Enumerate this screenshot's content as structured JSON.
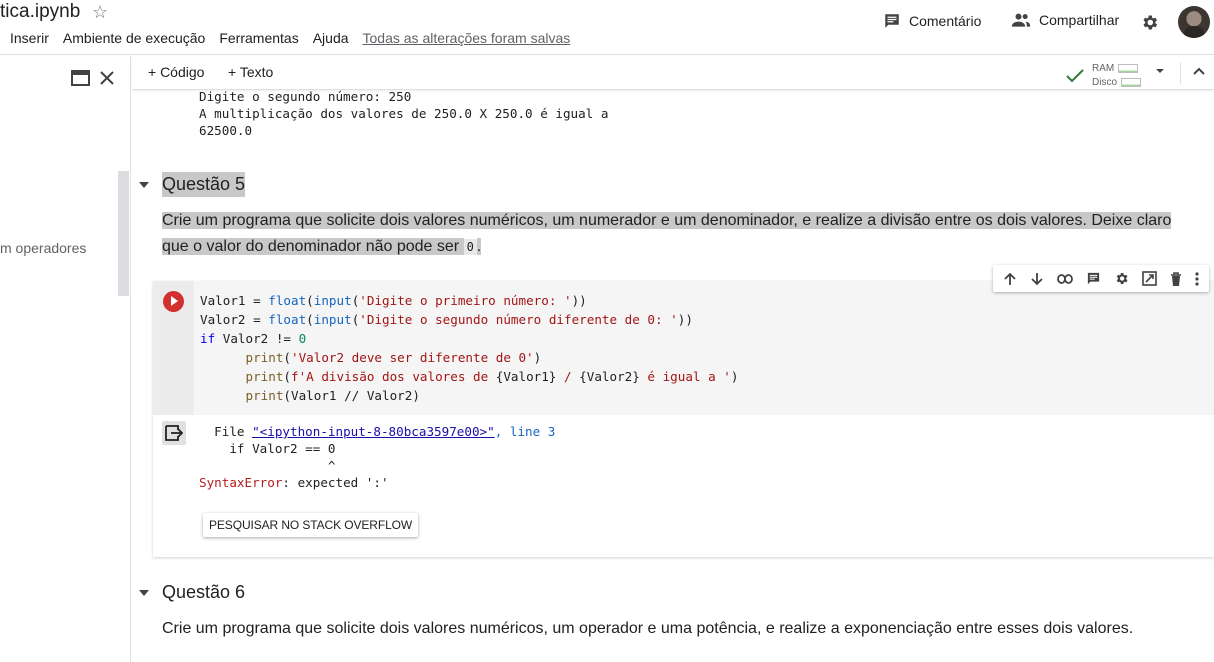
{
  "header": {
    "file_title": "tica.ipynb",
    "menu": [
      "Inserir",
      "Ambiente de execução",
      "Ferramentas",
      "Ajuda"
    ],
    "save_status": "Todas as alterações foram salvas",
    "comment_label": "Comentário",
    "share_label": "Compartilhar"
  },
  "sidebar": {
    "toc_item": "m operadores"
  },
  "toolbar": {
    "add_code": "+ Código",
    "add_text": "+ Texto",
    "ram_label": "RAM",
    "disk_label": "Disco"
  },
  "prev_output": {
    "lines": [
      "Digite o segundo número: 250",
      "A multiplicação dos valores de 250.0 X 250.0 é igual a",
      "62500.0"
    ]
  },
  "section5": {
    "title": "Questão 5",
    "description_part1": "Crie um programa que solicite dois valores numéricos, um numerador e um denominador, e realize a divisão entre os dois valores. Deixe claro que o valor do denominador não pode ser",
    "inline_code": "0",
    "description_end": "."
  },
  "code_cell": {
    "line1": {
      "var": "Valor1",
      "eq": " = ",
      "fn1": "float",
      "p1": "(",
      "fn2": "input",
      "p2": "(",
      "str": "'Digite o primeiro número: '",
      "p3": "))"
    },
    "line2": {
      "var": "Valor2",
      "eq": " = ",
      "fn1": "float",
      "p1": "(",
      "fn2": "input",
      "p2": "(",
      "str": "'Digite o segundo número diferente de 0: '",
      "p3": "))"
    },
    "line3": {
      "kw": "if",
      "rest": " Valor2 != ",
      "num": "0"
    },
    "line4": {
      "indent": "      ",
      "fn": "print",
      "p1": "(",
      "str": "'Valor2 deve ser diferente de 0'",
      "p2": ")"
    },
    "line5": {
      "indent": "      ",
      "fn": "print",
      "p1": "(",
      "str_a": "f'A divisão dos valores de ",
      "b1": "{Valor1}",
      "str_b": " / ",
      "b2": "{Valor2}",
      "str_c": " é igual a '",
      "p2": ")"
    },
    "line6": {
      "indent": "      ",
      "fn": "print",
      "rest": "(Valor1 // Valor2)"
    }
  },
  "output": {
    "file_prefix": "  File ",
    "file_link": "\"<ipython-input-8-80bca3597e00>\"",
    "line_ref": ", line 3",
    "code_line": "    if Valor2 == 0",
    "caret_line": "                 ^",
    "error_name": "SyntaxError",
    "error_msg": ": expected ':'",
    "so_button": "PESQUISAR NO STACK OVERFLOW"
  },
  "section6": {
    "title": "Questão 6",
    "description": "Crie um programa que solicite dois valores numéricos, um operador e uma potência, e realize a exponenciação entre esses dois valores."
  }
}
